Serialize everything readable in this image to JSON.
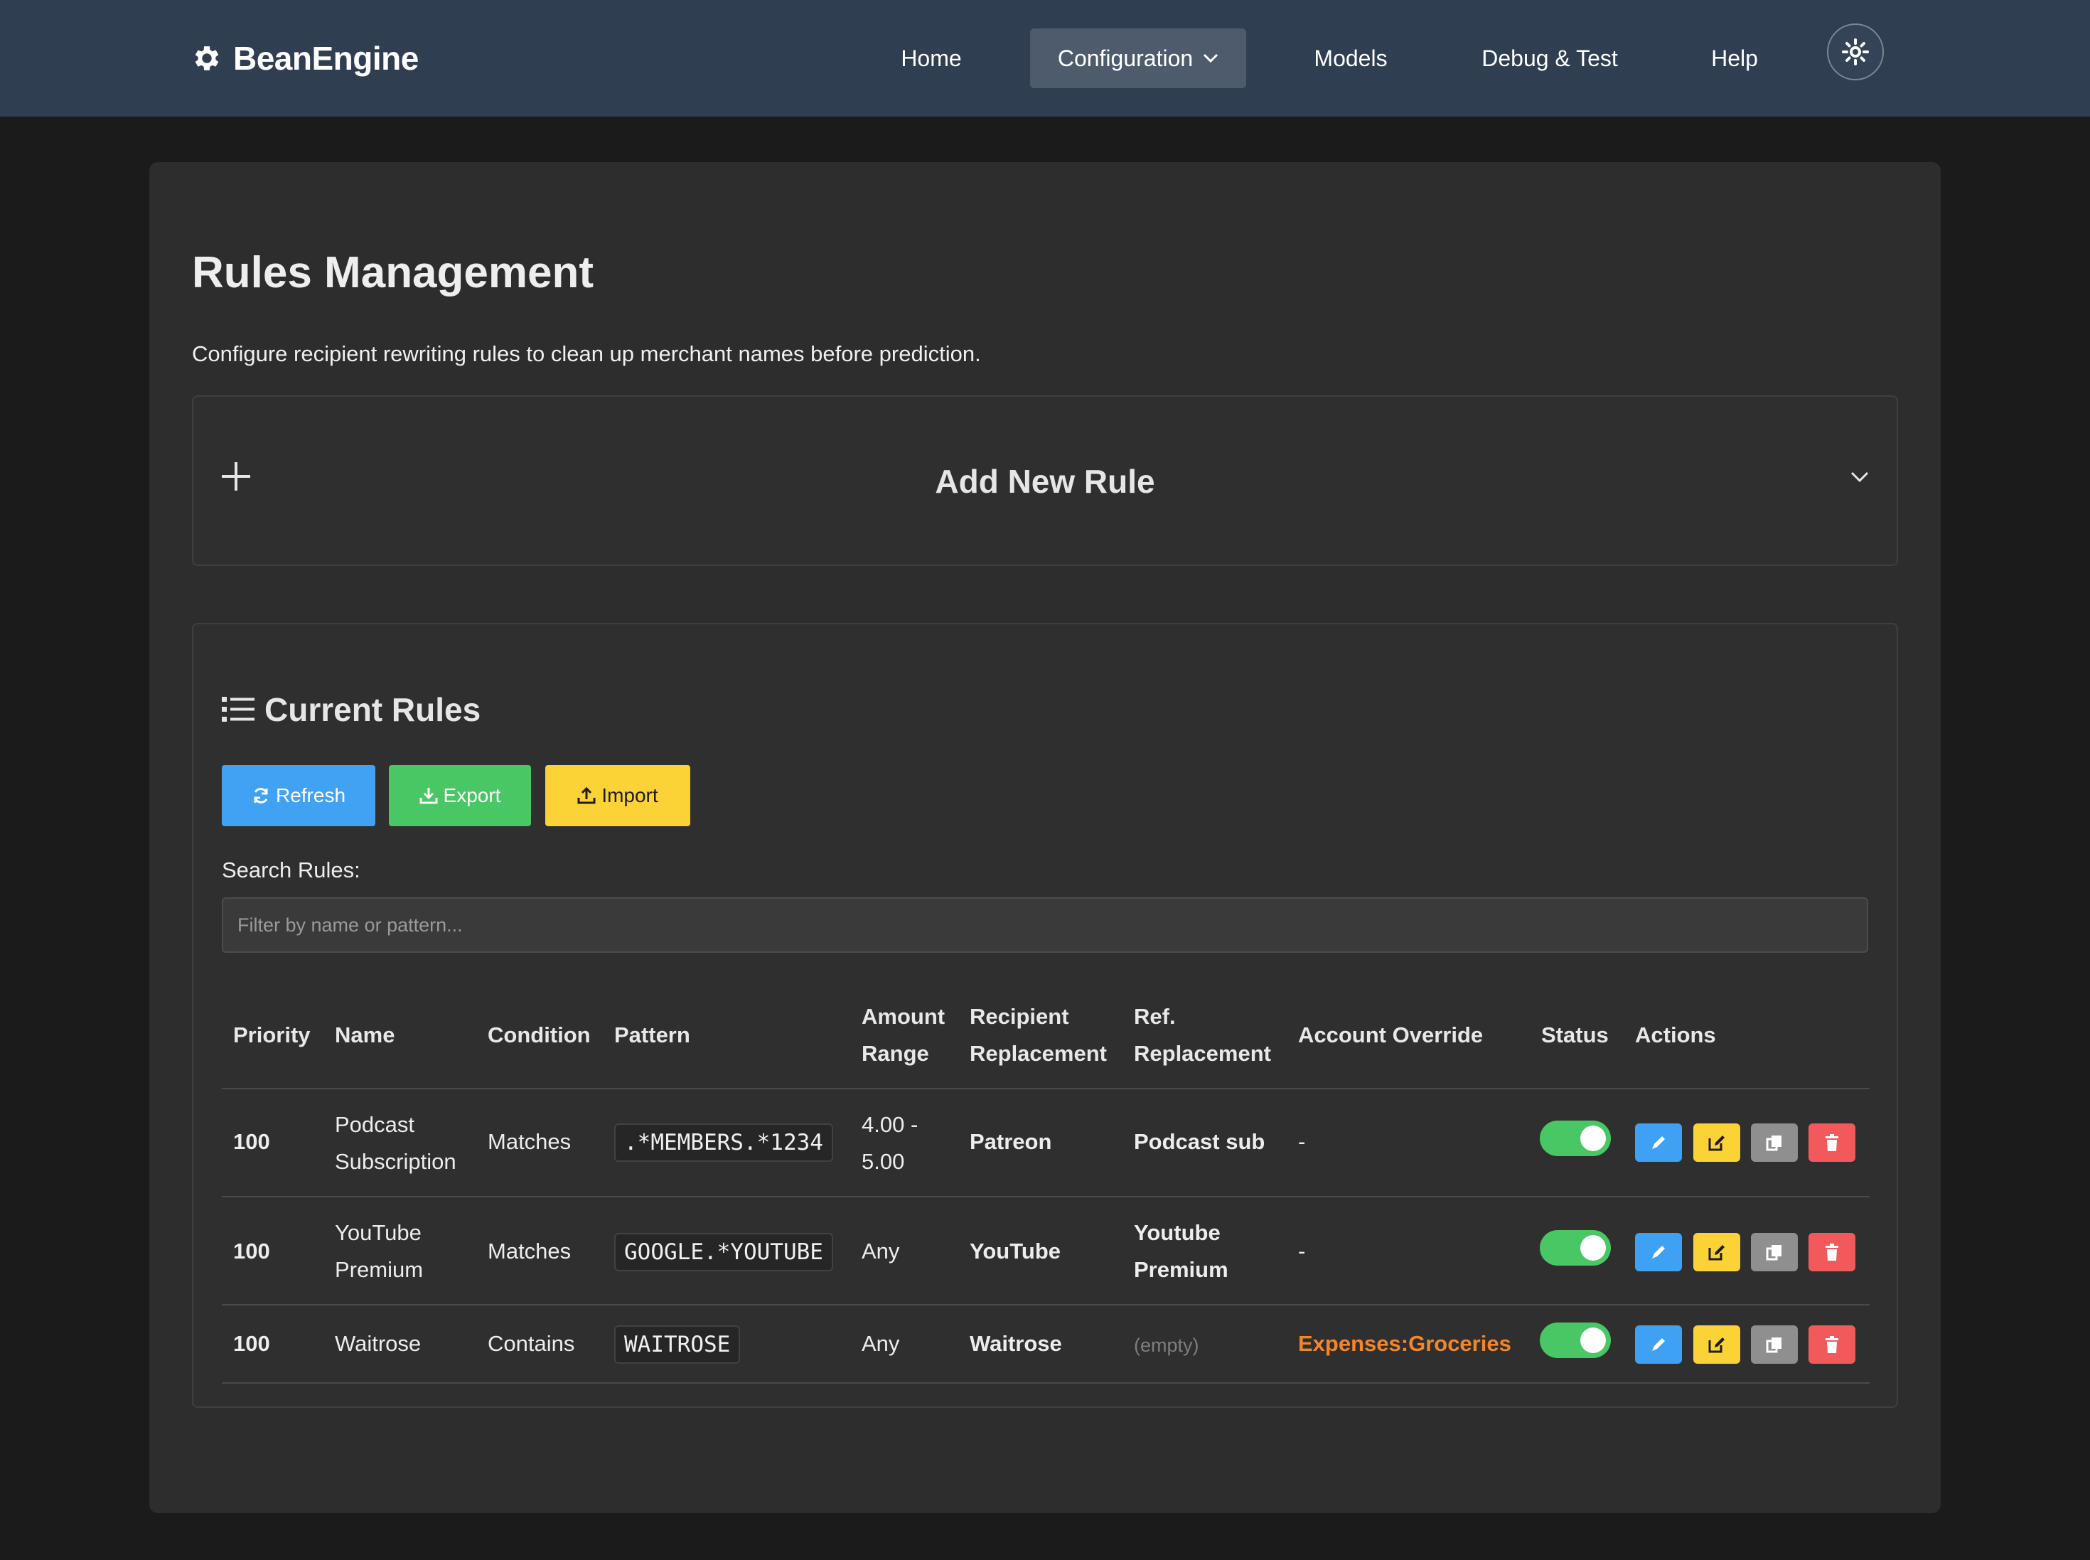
{
  "navbar": {
    "brand": "BeanEngine",
    "items": [
      {
        "label": "Home"
      },
      {
        "label": "Configuration"
      },
      {
        "label": "Models"
      },
      {
        "label": "Debug & Test"
      },
      {
        "label": "Help"
      }
    ]
  },
  "page": {
    "title": "Rules Management",
    "description": "Configure recipient rewriting rules to clean up merchant names before prediction."
  },
  "add_rule": {
    "title": "Add New Rule"
  },
  "current_rules": {
    "title": "Current Rules",
    "buttons": {
      "refresh": "Refresh",
      "export": "Export",
      "import": "Import"
    },
    "search": {
      "label": "Search Rules:",
      "placeholder": "Filter by name or pattern...",
      "value": ""
    },
    "columns": {
      "priority": "Priority",
      "name": "Name",
      "condition": "Condition",
      "pattern": "Pattern",
      "amount_1": "Amount",
      "amount_2": "Range",
      "recipient_1": "Recipient",
      "recipient_2": "Replacement",
      "ref_1": "Ref.",
      "ref_2": "Replacement",
      "account_override": "Account Override",
      "status": "Status",
      "actions": "Actions"
    },
    "rows": [
      {
        "priority": "100",
        "name_1": "Podcast",
        "name_2": "Subscription",
        "condition": "Matches",
        "pattern": ".*MEMBERS.*1234",
        "amount_1": "4.00 -",
        "amount_2": "5.00",
        "recipient": "Patreon",
        "ref": "Podcast sub",
        "account": "-",
        "enabled": true
      },
      {
        "priority": "100",
        "name_1": "YouTube",
        "name_2": "Premium",
        "condition": "Matches",
        "pattern": "GOOGLE.*YOUTUBE",
        "amount": "Any",
        "recipient": "YouTube",
        "ref_1": "Youtube",
        "ref_2": "Premium",
        "account": "-",
        "enabled": true
      },
      {
        "priority": "100",
        "name": "Waitrose",
        "condition": "Contains",
        "pattern": "WAITROSE",
        "amount": "Any",
        "recipient": "Waitrose",
        "ref": "(empty)",
        "account": "Expenses:Groceries",
        "enabled": true
      }
    ]
  }
}
